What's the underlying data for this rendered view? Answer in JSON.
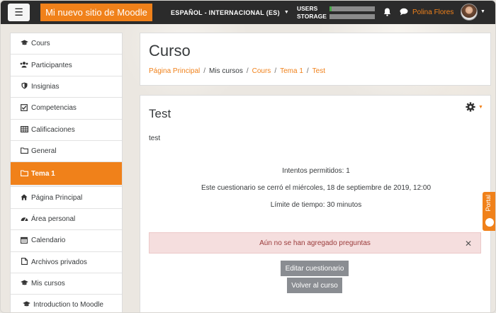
{
  "navbar": {
    "site_name": "Mi nuevo sitio de Moodle",
    "language": "ESPAÑOL - INTERNACIONAL (ES)",
    "usage": [
      {
        "label": "USERS",
        "fill_percent": 5
      },
      {
        "label": "STORAGE",
        "fill_percent": 0
      }
    ],
    "user_name": "Polina Flores"
  },
  "sidebar": {
    "items": [
      {
        "label": "Cours",
        "icon": "graduation-cap-icon"
      },
      {
        "label": "Participantes",
        "icon": "users-icon"
      },
      {
        "label": "Insignias",
        "icon": "shield-icon"
      },
      {
        "label": "Competencias",
        "icon": "check-square-icon"
      },
      {
        "label": "Calificaciones",
        "icon": "table-icon"
      },
      {
        "label": "General",
        "icon": "folder-icon"
      },
      {
        "label": "Tema 1",
        "icon": "folder-icon",
        "active": true
      }
    ],
    "items2": [
      {
        "label": "Página Principal",
        "icon": "home-icon"
      },
      {
        "label": "Área personal",
        "icon": "dashboard-icon"
      },
      {
        "label": "Calendario",
        "icon": "calendar-icon"
      },
      {
        "label": "Archivos privados",
        "icon": "file-icon"
      },
      {
        "label": "Mis cursos",
        "icon": "graduation-cap-icon"
      },
      {
        "label": "Introduction to Moodle",
        "icon": "graduation-cap-icon"
      }
    ]
  },
  "header": {
    "title": "Curso",
    "breadcrumb": [
      "Página Principal",
      "Mis cursos",
      "Cours",
      "Tema 1",
      "Test"
    ]
  },
  "main": {
    "title": "Test",
    "intro": "test",
    "attempts": "Intentos permitidos: 1",
    "closed": "Este cuestionario se cerró el miércoles, 18 de septiembre de 2019, 12:00",
    "time_limit": "Límite de tiempo: 30 minutos",
    "alert": "Aún no se han agregado preguntas",
    "edit_button": "Editar cuestionario",
    "back_button": "Volver al curso"
  },
  "portal_tab": {
    "label": "Portal"
  },
  "colors": {
    "accent": "#f0811a",
    "navbar": "#2b2b2b",
    "alert_bg": "#f5dede",
    "button": "#8a8d92"
  }
}
